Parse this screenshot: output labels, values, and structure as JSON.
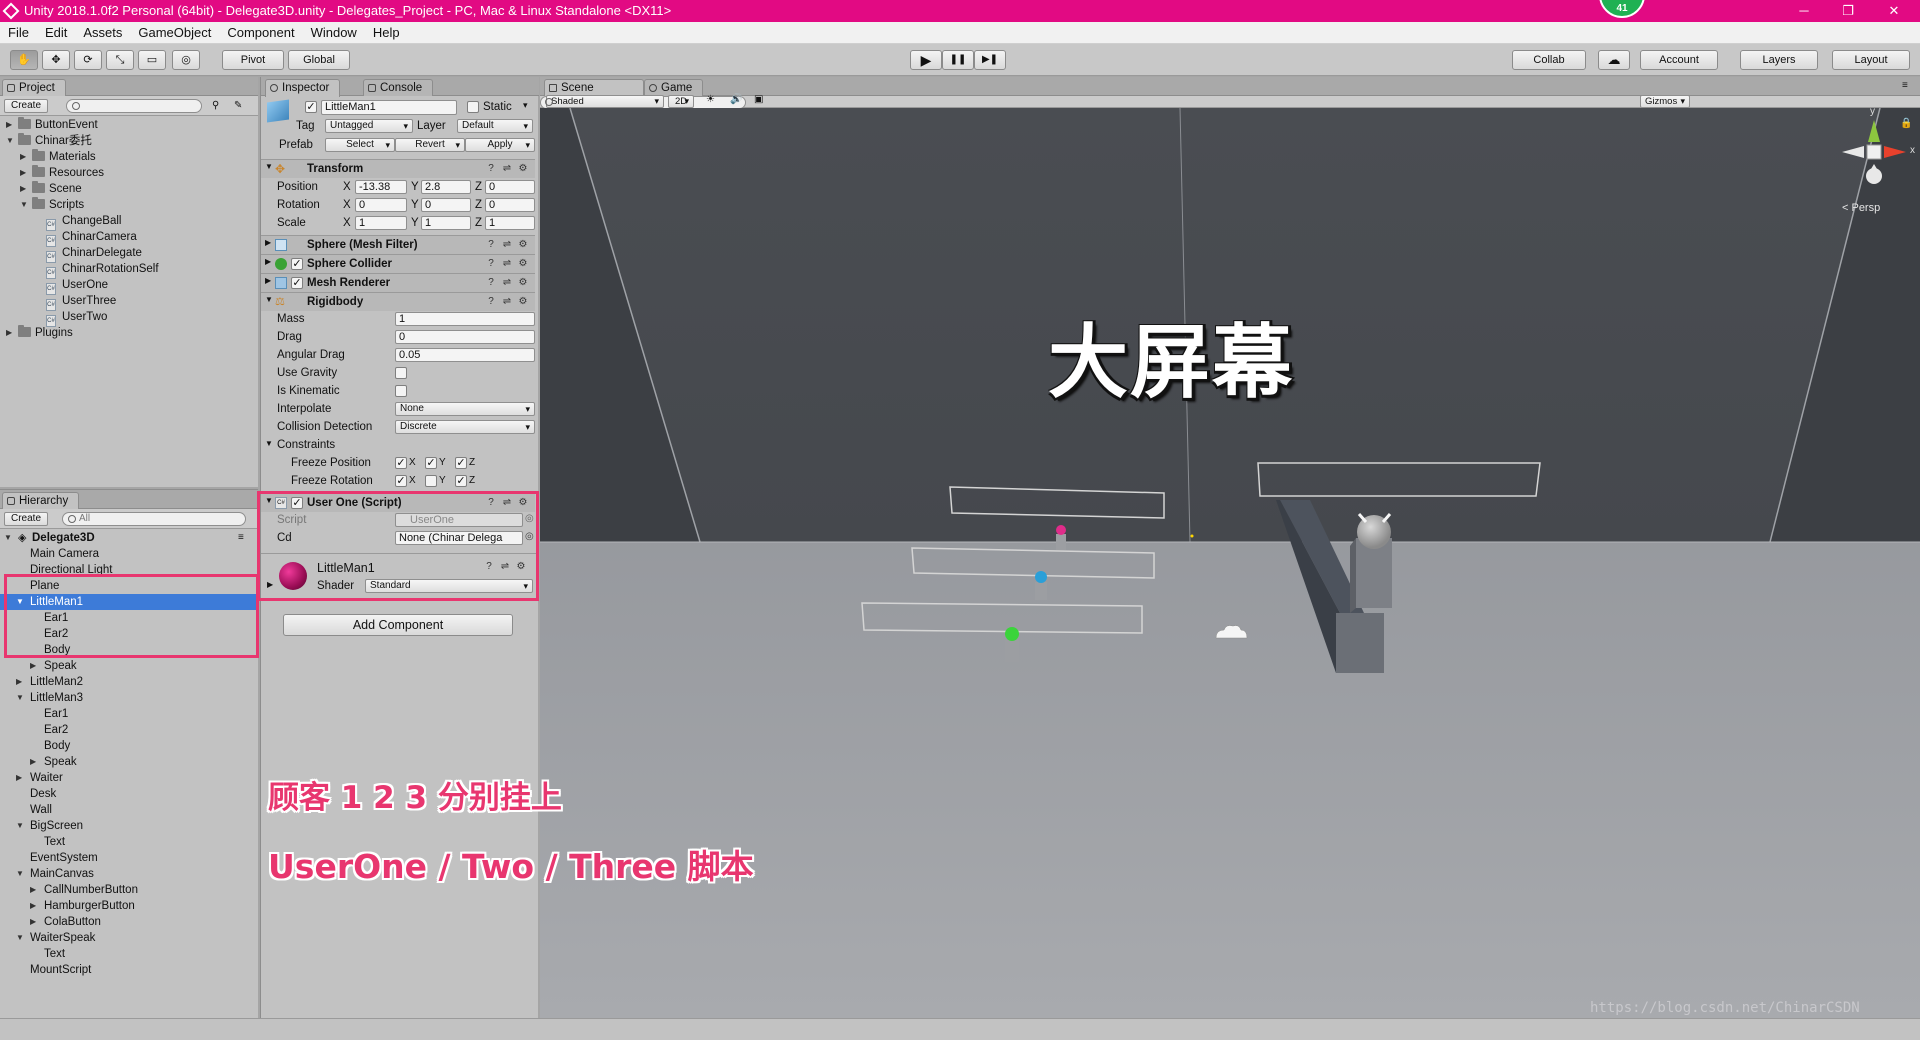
{
  "window": {
    "title": "Unity 2018.1.0f2 Personal (64bit) - Delegate3D.unity - Delegates_Project - PC, Mac & Linux Standalone <DX11>",
    "notification_count": "41",
    "minimize": "─",
    "maximize": "❐",
    "close": "✕"
  },
  "menu": [
    "File",
    "Edit",
    "Assets",
    "GameObject",
    "Component",
    "Window",
    "Help"
  ],
  "toolbar": {
    "tools": [
      "✋",
      "✥",
      "⟳",
      "⤡",
      "▭",
      "◎"
    ],
    "pivot": "Pivot",
    "global": "Global",
    "play": "▶",
    "pause": "❚❚",
    "step": "▶❚",
    "collab": "Collab",
    "cloud": "☁",
    "account": "Account",
    "layers": "Layers",
    "layout": "Layout"
  },
  "project": {
    "tab": "Project",
    "create": "Create",
    "items": [
      {
        "label": "ButtonEvent",
        "depth": 0,
        "folder": true,
        "arrow": "▶"
      },
      {
        "label": "Chinar委托",
        "depth": 0,
        "folder": true,
        "arrow": "▼"
      },
      {
        "label": "Materials",
        "depth": 1,
        "folder": true,
        "arrow": "▶"
      },
      {
        "label": "Resources",
        "depth": 1,
        "folder": true,
        "arrow": "▶"
      },
      {
        "label": "Scene",
        "depth": 1,
        "folder": true,
        "arrow": "▶"
      },
      {
        "label": "Scripts",
        "depth": 1,
        "folder": true,
        "arrow": "▼"
      },
      {
        "label": "ChangeBall",
        "depth": 2,
        "folder": false,
        "arrow": ""
      },
      {
        "label": "ChinarCamera",
        "depth": 2,
        "folder": false,
        "arrow": ""
      },
      {
        "label": "ChinarDelegate",
        "depth": 2,
        "folder": false,
        "arrow": ""
      },
      {
        "label": "ChinarRotationSelf",
        "depth": 2,
        "folder": false,
        "arrow": ""
      },
      {
        "label": "UserOne",
        "depth": 2,
        "folder": false,
        "arrow": ""
      },
      {
        "label": "UserThree",
        "depth": 2,
        "folder": false,
        "arrow": ""
      },
      {
        "label": "UserTwo",
        "depth": 2,
        "folder": false,
        "arrow": ""
      },
      {
        "label": "Plugins",
        "depth": 0,
        "folder": true,
        "arrow": "▶"
      }
    ]
  },
  "hierarchy": {
    "tab": "Hierarchy",
    "create": "Create",
    "search_placeholder": "All",
    "scene_name": "Delegate3D",
    "items": [
      {
        "label": "Main Camera",
        "depth": 1,
        "arrow": ""
      },
      {
        "label": "Directional Light",
        "depth": 1,
        "arrow": ""
      },
      {
        "label": "Plane",
        "depth": 1,
        "arrow": ""
      },
      {
        "label": "LittleMan1",
        "depth": 1,
        "arrow": "▼",
        "selected": true
      },
      {
        "label": "Ear1",
        "depth": 2,
        "arrow": ""
      },
      {
        "label": "Ear2",
        "depth": 2,
        "arrow": ""
      },
      {
        "label": "Body",
        "depth": 2,
        "arrow": ""
      },
      {
        "label": "Speak",
        "depth": 2,
        "arrow": "▶"
      },
      {
        "label": "LittleMan2",
        "depth": 1,
        "arrow": "▶"
      },
      {
        "label": "LittleMan3",
        "depth": 1,
        "arrow": "▼"
      },
      {
        "label": "Ear1",
        "depth": 2,
        "arrow": ""
      },
      {
        "label": "Ear2",
        "depth": 2,
        "arrow": ""
      },
      {
        "label": "Body",
        "depth": 2,
        "arrow": ""
      },
      {
        "label": "Speak",
        "depth": 2,
        "arrow": "▶"
      },
      {
        "label": "Waiter",
        "depth": 1,
        "arrow": "▶"
      },
      {
        "label": "Desk",
        "depth": 1,
        "arrow": ""
      },
      {
        "label": "Wall",
        "depth": 1,
        "arrow": ""
      },
      {
        "label": "BigScreen",
        "depth": 1,
        "arrow": "▼"
      },
      {
        "label": "Text",
        "depth": 2,
        "arrow": ""
      },
      {
        "label": "EventSystem",
        "depth": 1,
        "arrow": ""
      },
      {
        "label": "MainCanvas",
        "depth": 1,
        "arrow": "▼"
      },
      {
        "label": "CallNumberButton",
        "depth": 2,
        "arrow": "▶"
      },
      {
        "label": "HamburgerButton",
        "depth": 2,
        "arrow": "▶"
      },
      {
        "label": "ColaButton",
        "depth": 2,
        "arrow": "▶"
      },
      {
        "label": "WaiterSpeak",
        "depth": 1,
        "arrow": "▼"
      },
      {
        "label": "Text",
        "depth": 2,
        "arrow": ""
      },
      {
        "label": "MountScript",
        "depth": 1,
        "arrow": ""
      }
    ]
  },
  "inspector": {
    "tab": "Inspector",
    "console_tab": "Console",
    "object_name": "LittleMan1",
    "static_label": "Static",
    "tag_label": "Tag",
    "tag_value": "Untagged",
    "layer_label": "Layer",
    "layer_value": "Default",
    "prefab_label": "Prefab",
    "prefab_select": "Select",
    "prefab_revert": "Revert",
    "prefab_apply": "Apply",
    "transform": {
      "title": "Transform",
      "position_label": "Position",
      "rotation_label": "Rotation",
      "scale_label": "Scale",
      "axis_x": "X",
      "axis_y": "Y",
      "axis_z": "Z",
      "position": {
        "x": "-13.38",
        "y": "2.8",
        "z": "0"
      },
      "rotation": {
        "x": "0",
        "y": "0",
        "z": "0"
      },
      "scale": {
        "x": "1",
        "y": "1",
        "z": "1"
      }
    },
    "mesh_filter": "Sphere (Mesh Filter)",
    "sphere_collider": "Sphere Collider",
    "mesh_renderer": "Mesh Renderer",
    "rigidbody": {
      "title": "Rigidbody",
      "mass_label": "Mass",
      "mass": "1",
      "drag_label": "Drag",
      "drag": "0",
      "angular_drag_label": "Angular Drag",
      "angular_drag": "0.05",
      "use_gravity_label": "Use Gravity",
      "is_kinematic_label": "Is Kinematic",
      "interpolate_label": "Interpolate",
      "interpolate": "None",
      "collision_label": "Collision Detection",
      "collision": "Discrete",
      "constraints_label": "Constraints",
      "freeze_position_label": "Freeze Position",
      "freeze_rotation_label": "Freeze Rotation",
      "x": "X",
      "y": "Y",
      "z": "Z"
    },
    "user_one": {
      "title": "User One (Script)",
      "script_label": "Script",
      "script_value": "UserOne",
      "cd_label": "Cd",
      "cd_value": "None (Chinar Delega"
    },
    "material": {
      "name": "LittleMan1",
      "shader_label": "Shader",
      "shader_value": "Standard"
    },
    "add_component": "Add Component"
  },
  "scene": {
    "tab": "Scene",
    "game_tab": "Game",
    "shading": "Shaded",
    "mode_2d": "2D",
    "gizmos": "Gizmos",
    "search_placeholder": "All",
    "persp": "< Persp",
    "gizmo_y": "y",
    "gizmo_x": "x",
    "big_screen_text": "大屏幕"
  },
  "annotations": {
    "line1": "顾客 1 2 3 分别挂上",
    "line2": "UserOne / Two / Three 脚本"
  },
  "watermark": "https://blog.csdn.net/ChinarCSDN",
  "colors": {
    "title_bar": "#e20a83",
    "highlight_box": "#e8366f",
    "selection": "#3d7bd8",
    "sky_wall": "#464a4f",
    "floor": "#9ea0a5"
  }
}
